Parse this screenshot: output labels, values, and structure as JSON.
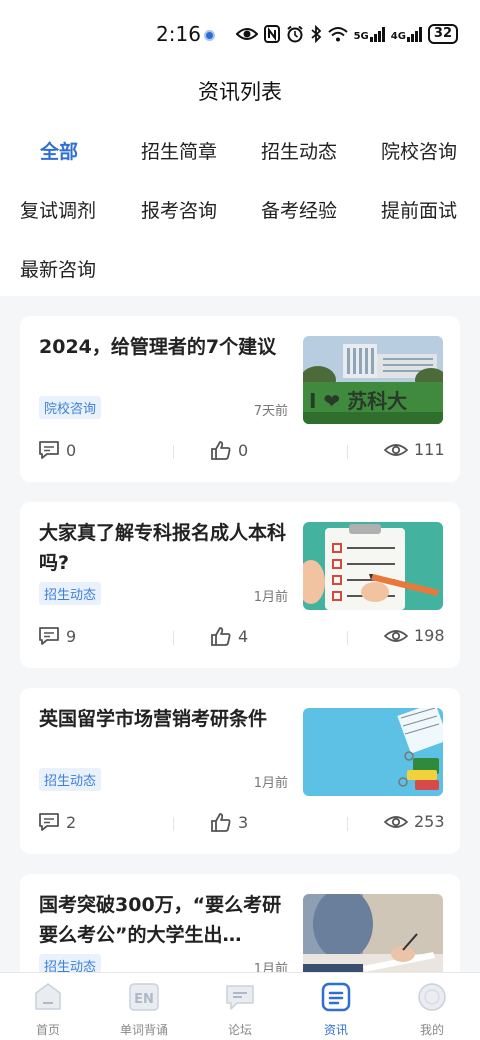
{
  "status_bar": {
    "time": "2:16",
    "network_label": "5G",
    "network_label_2": "4G",
    "battery": "32"
  },
  "page_title": "资讯列表",
  "tabs": [
    {
      "label": "全部",
      "active": true
    },
    {
      "label": "招生简章"
    },
    {
      "label": "招生动态"
    },
    {
      "label": "院校咨询"
    },
    {
      "label": "复试调剂"
    },
    {
      "label": "报考咨询"
    },
    {
      "label": "备考经验"
    },
    {
      "label": "提前面试"
    },
    {
      "label": "最新咨询"
    }
  ],
  "articles": [
    {
      "title": "2024，给管理者的7个建议",
      "tag": "院校咨询",
      "time": "7天前",
      "comments": "0",
      "likes": "0",
      "views": "111",
      "image_text": "I ❤ 苏科大"
    },
    {
      "title": "大家真了解专科报名成人本科吗?",
      "tag": "招生动态",
      "time": "1月前",
      "comments": "9",
      "likes": "4",
      "views": "198"
    },
    {
      "title": "英国留学市场营销考研条件",
      "tag": "招生动态",
      "time": "1月前",
      "comments": "2",
      "likes": "3",
      "views": "253"
    },
    {
      "title": "国考突破300万，“要么考研要么考公”的大学生出…",
      "tag": "招生动态",
      "time": "1月前"
    }
  ],
  "bottom_nav": [
    {
      "label": "首页"
    },
    {
      "label": "单词背诵",
      "icon_text": "EN"
    },
    {
      "label": "论坛"
    },
    {
      "label": "资讯",
      "active": true
    },
    {
      "label": "我的"
    }
  ],
  "colors": {
    "accent": "#2f6fd0",
    "tag_bg": "#e9f1fc",
    "tag_text": "#3d7fd9",
    "background": "#f5f6f8"
  }
}
